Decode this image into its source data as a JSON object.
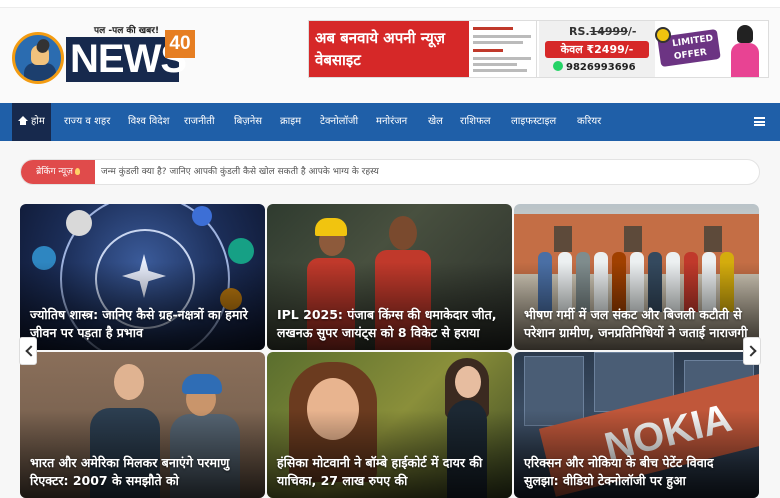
{
  "logo": {
    "tagline": "पल -पल की खबर!",
    "wordmark": "NEWS",
    "number": "40"
  },
  "banner": {
    "headline": "अब बनवाये अपनी न्यूज़ वेबसाइट",
    "old_price_prefix": "RS.",
    "old_price": "14999",
    "old_price_suffix": "/-",
    "new_price": "केवल ₹2499/-",
    "phone": "9826993696",
    "offer": "LIMITED OFFER"
  },
  "nav": {
    "items": [
      {
        "label": "होम",
        "active": true
      },
      {
        "label": "राज्य व शहर"
      },
      {
        "label": "विश्व विदेश"
      },
      {
        "label": "राजनीती"
      },
      {
        "label": "बिज़नेस"
      },
      {
        "label": "क्राइम"
      },
      {
        "label": "टेक्नोलॉजी"
      },
      {
        "label": "मनोरंजन"
      },
      {
        "label": "खेल"
      },
      {
        "label": "राशिफल"
      },
      {
        "label": "लाइफस्टाइल"
      },
      {
        "label": "करियर"
      }
    ],
    "menu_icon": "hamburger-icon"
  },
  "ticker": {
    "label": "ब्रेकिंग न्यूज़",
    "text": "जन्म कुंडली क्या है? जानिए आपकी कुंडली कैसे खोल सकती है आपके भाग्य के रहस्य"
  },
  "cards": [
    {
      "title": "ज्योतिष शास्त्र: जानिए कैसे ग्रह-नक्षत्रों का हमारे जीवन पर पड़ता है प्रभाव"
    },
    {
      "title": "IPL 2025: पंजाब किंग्स की धमाकेदार जीत, लखनऊ सुपर जायंट्स को 8 विकेट से हराया"
    },
    {
      "title": "भीषण गर्मी में जल संकट और बिजली कटौती से परेशान ग्रामीण, जनप्रतिनिधियों ने जताई नाराजगी"
    },
    {
      "title": "भारत और अमेरिका मिलकर बनाएंगे परमाणु रिएक्टर: 2007 के समझौते को"
    },
    {
      "title": "हंसिका मोटवानी ने बॉम्बे हाईकोर्ट में दायर की याचिका, 27 लाख रुपए की"
    },
    {
      "title": "एरिक्सन और नोकिया के बीच पेटेंट विवाद सुलझा: वीडियो टेक्नोलॉजी पर हुआ"
    }
  ],
  "card6_sign": "NOKIA",
  "colors": {
    "nav_bg": "#1f5fa8",
    "nav_active": "#17294d",
    "ticker_label": "#e04b4b",
    "banner_red": "#d62828"
  }
}
